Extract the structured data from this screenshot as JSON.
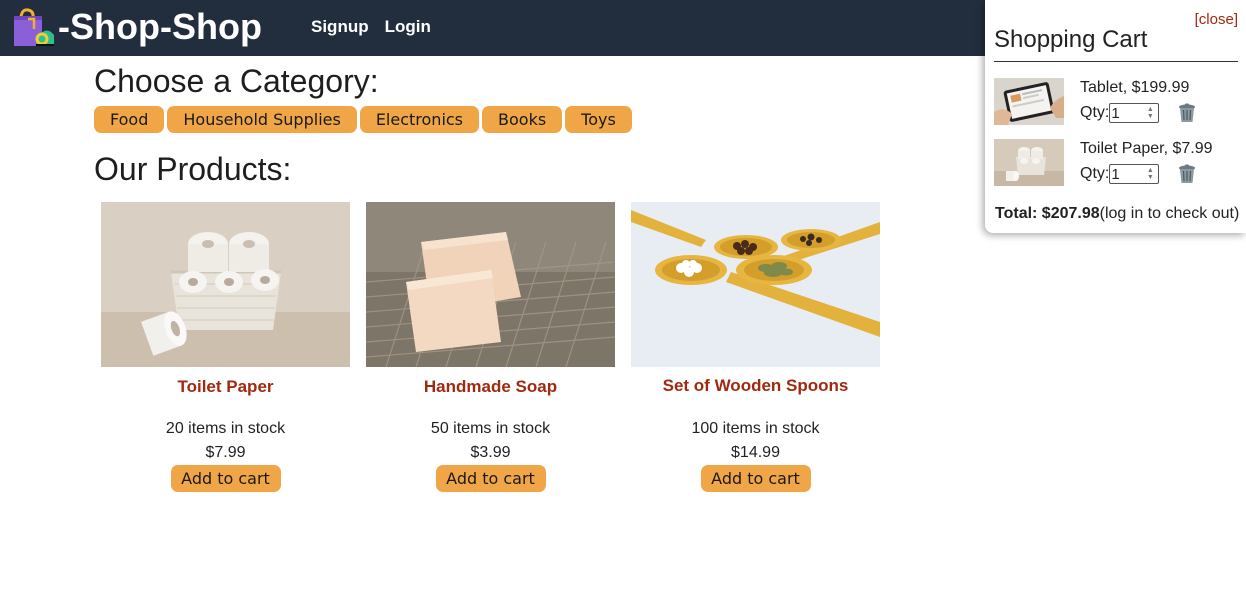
{
  "header": {
    "logo_text": "-Shop-Shop",
    "nav": [
      "Signup",
      "Login"
    ],
    "colors": {
      "background": "#222e3e",
      "text": "#ffffff"
    }
  },
  "categories": {
    "title": "Choose a Category:",
    "items": [
      "Food",
      "Household Supplies",
      "Electronics",
      "Books",
      "Toys"
    ],
    "button_color": "#f0a646"
  },
  "products": {
    "title": "Our Products:",
    "items": [
      {
        "name": "Toilet Paper",
        "stock": "20 items in stock",
        "price": "$7.99",
        "button": "Add to cart",
        "image": "toilet-paper-image"
      },
      {
        "name": "Handmade Soap",
        "stock": "50 items in stock",
        "price": "$3.99",
        "button": "Add to cart",
        "image": "soap-image"
      },
      {
        "name": "Set of Wooden Spoons",
        "stock": "100 items in stock",
        "price": "$14.99",
        "button": "Add to cart",
        "image": "wooden-spoons-image"
      }
    ],
    "name_color": "#a02a10"
  },
  "cart": {
    "close": "[close]",
    "title": "Shopping Cart",
    "items": [
      {
        "desc": "Tablet, $199.99",
        "qty_label": "Qty:",
        "qty": "1",
        "image": "tablet-image"
      },
      {
        "desc": "Toilet Paper, $7.99",
        "qty_label": "Qty:",
        "qty": "1",
        "image": "toilet-paper-image"
      }
    ],
    "total_label": "Total: $207.98",
    "total_note": "(log in to check out)"
  }
}
